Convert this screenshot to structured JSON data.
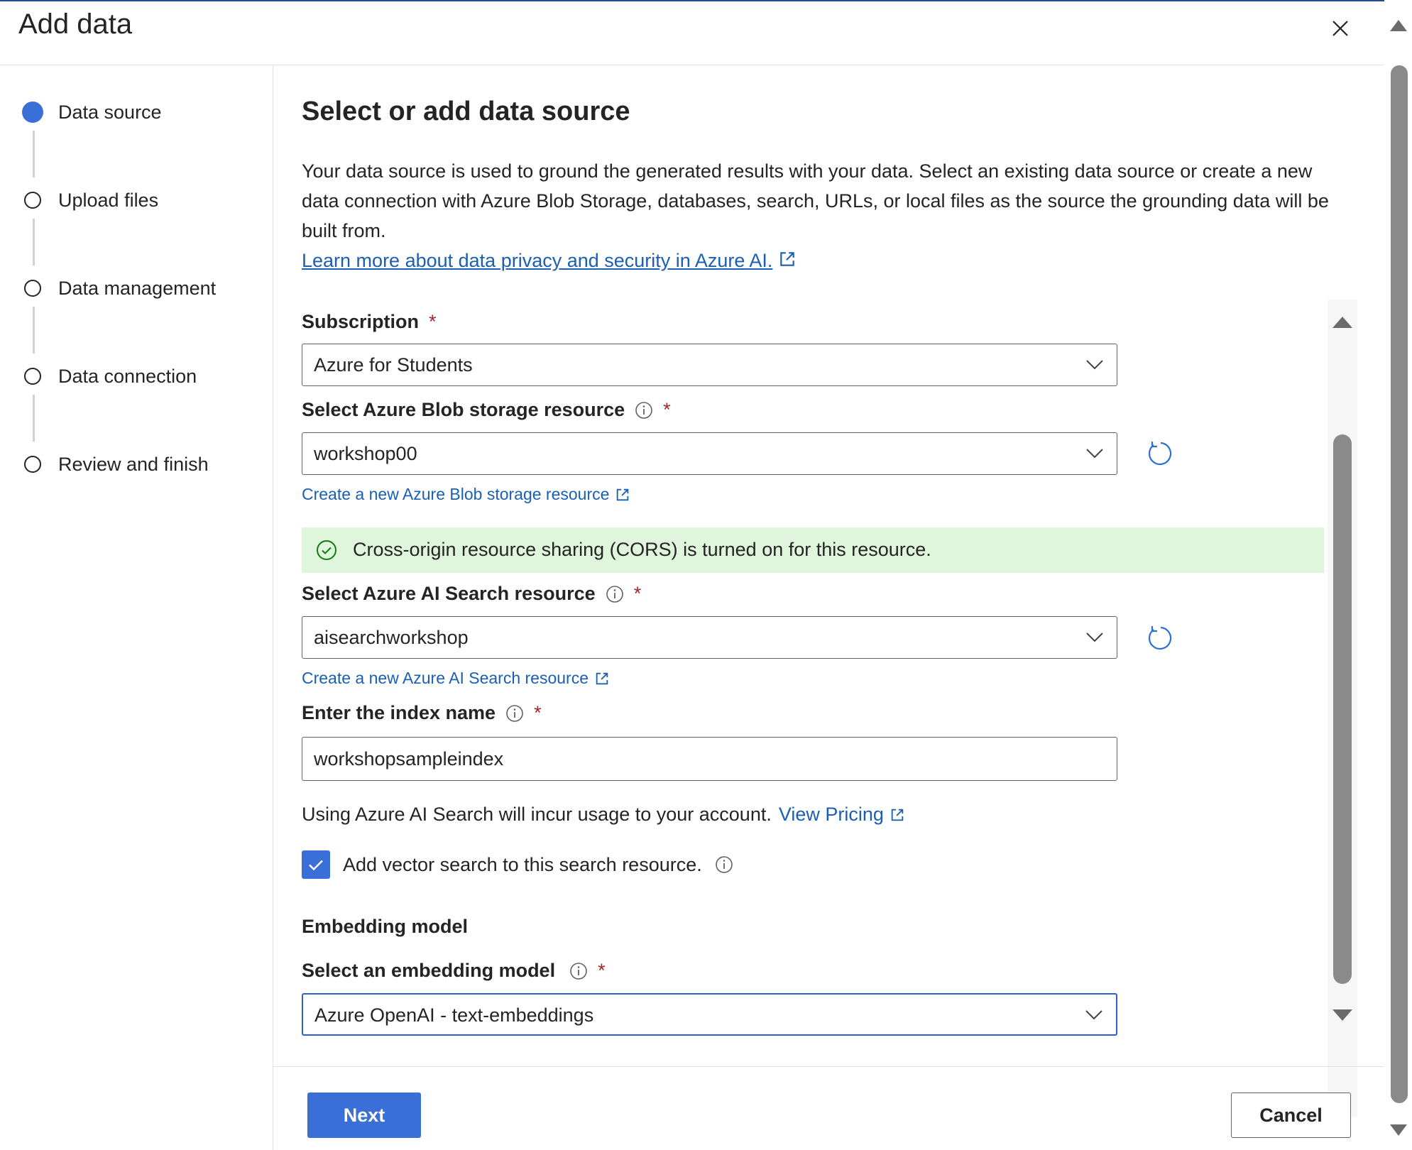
{
  "dialog": {
    "title": "Add data",
    "close_icon": "close-icon"
  },
  "steps": [
    {
      "label": "Data source",
      "state": "active"
    },
    {
      "label": "Upload files",
      "state": "pending"
    },
    {
      "label": "Data management",
      "state": "pending"
    },
    {
      "label": "Data connection",
      "state": "pending"
    },
    {
      "label": "Review and finish",
      "state": "pending"
    }
  ],
  "main": {
    "heading": "Select or add data source",
    "description": "Your data source is used to ground the generated results with your data. Select an existing data source or create a new data connection with Azure Blob Storage, databases, search, URLs, or local files as the source the grounding data will be built from.",
    "learn_more_link": "Learn more about data privacy and security in Azure AI."
  },
  "form": {
    "subscription": {
      "label": "Subscription",
      "required_mark": "*",
      "value": "Azure for Students"
    },
    "blob": {
      "label": "Select Azure Blob storage resource",
      "required_mark": "*",
      "value": "workshop00",
      "create_link": "Create a new Azure Blob storage resource"
    },
    "cors_banner": {
      "text": "Cross-origin resource sharing (CORS) is turned on for this resource."
    },
    "search": {
      "label": "Select Azure AI Search resource",
      "required_mark": "*",
      "value": "aisearchworkshop",
      "create_link": "Create a new Azure AI Search resource"
    },
    "index": {
      "label": "Enter the index name",
      "required_mark": "*",
      "value": "workshopsampleindex"
    },
    "pricing": {
      "text": "Using Azure AI Search will incur usage to your account.",
      "link": "View Pricing"
    },
    "vector": {
      "label": "Add vector search to this search resource.",
      "checked": true
    },
    "embedding_section": "Embedding model",
    "embedding": {
      "label": "Select an embedding model",
      "required_mark": "*",
      "value": "Azure OpenAI - text-embeddings"
    }
  },
  "footer": {
    "next_label": "Next",
    "cancel_label": "Cancel"
  },
  "colors": {
    "accent": "#3b6fd8",
    "link": "#1a5fb4",
    "success_bg": "#dff6dd",
    "success": "#107c10",
    "required": "#a4262c"
  }
}
